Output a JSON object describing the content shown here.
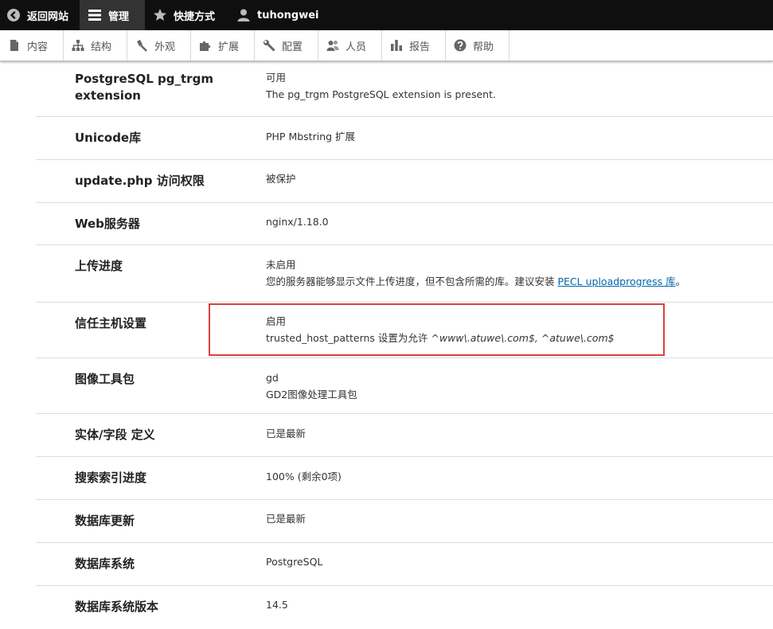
{
  "toolbar": {
    "back_label": "返回网站",
    "manage_label": "管理",
    "shortcuts_label": "快捷方式",
    "user_label": "tuhongwei"
  },
  "tray": [
    {
      "label": "内容",
      "icon": "file-icon"
    },
    {
      "label": "结构",
      "icon": "sitemap-icon"
    },
    {
      "label": "外观",
      "icon": "brush-icon"
    },
    {
      "label": "扩展",
      "icon": "puzzle-icon"
    },
    {
      "label": "配置",
      "icon": "wrench-icon"
    },
    {
      "label": "人员",
      "icon": "people-icon"
    },
    {
      "label": "报告",
      "icon": "bar-chart-icon"
    },
    {
      "label": "帮助",
      "icon": "help-icon"
    }
  ],
  "rows": [
    {
      "label": "PostgreSQL pg_trgm extension",
      "value": "可用",
      "detail": "The pg_trgm PostgreSQL extension is present."
    },
    {
      "label": "Unicode库",
      "value": "PHP Mbstring 扩展"
    },
    {
      "label": "update.php 访问权限",
      "value": "被保护"
    },
    {
      "label": "Web服务器",
      "value": "nginx/1.18.0"
    },
    {
      "label": "上传进度",
      "value": "未启用",
      "detail": "您的服务器能够显示文件上传进度，但不包含所需的库。建议安装 ",
      "link": "PECL uploadprogress 库",
      "detail_end": "。"
    },
    {
      "label": "信任主机设置",
      "value": "启用",
      "detail": "trusted_host_patterns 设置为允许 ",
      "detail_em": "^www\\.atuwe\\.com$, ^atuwe\\.com$"
    },
    {
      "label": "图像工具包",
      "value": "gd",
      "detail": "GD2图像处理工具包"
    },
    {
      "label": "实体/字段 定义",
      "value": "已是最新"
    },
    {
      "label": "搜索索引进度",
      "value": "100% (剩余0项)"
    },
    {
      "label": "数据库更新",
      "value": "已是最新"
    },
    {
      "label": "数据库系统",
      "value": "PostgreSQL"
    },
    {
      "label": "数据库系统版本",
      "value": "14.5"
    }
  ],
  "colors": {
    "toolbar_bg": "#0f0f0f",
    "active_tab_bg": "#333333",
    "highlight_border": "#d9413e",
    "link": "#0066aa"
  }
}
